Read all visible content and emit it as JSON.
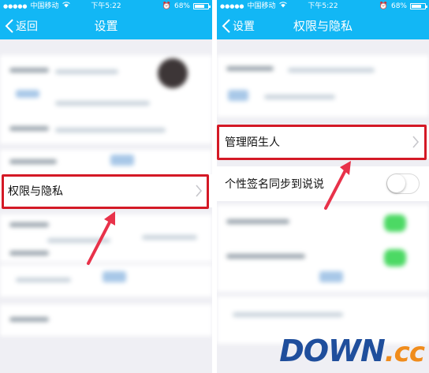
{
  "left_screen": {
    "status": {
      "carrier": "中国移动",
      "time": "下午5:22",
      "battery": "68%"
    },
    "nav": {
      "back_label": "返回",
      "title": "设置"
    },
    "highlighted_row": {
      "label": "权限与隐私"
    }
  },
  "right_screen": {
    "status": {
      "carrier": "中国移动",
      "time": "下午5:22",
      "battery": "68%"
    },
    "nav": {
      "back_label": "设置",
      "title": "权限与隐私"
    },
    "highlighted_row": {
      "label": "管理陌生人"
    },
    "toggle_row": {
      "label": "个性签名同步到说说",
      "enabled": false
    }
  },
  "watermark": {
    "part1": "DOWN",
    "part2": ".cc"
  },
  "colors": {
    "nav": "#12b7f5",
    "highlight": "#d41926",
    "background": "#efeff4"
  }
}
